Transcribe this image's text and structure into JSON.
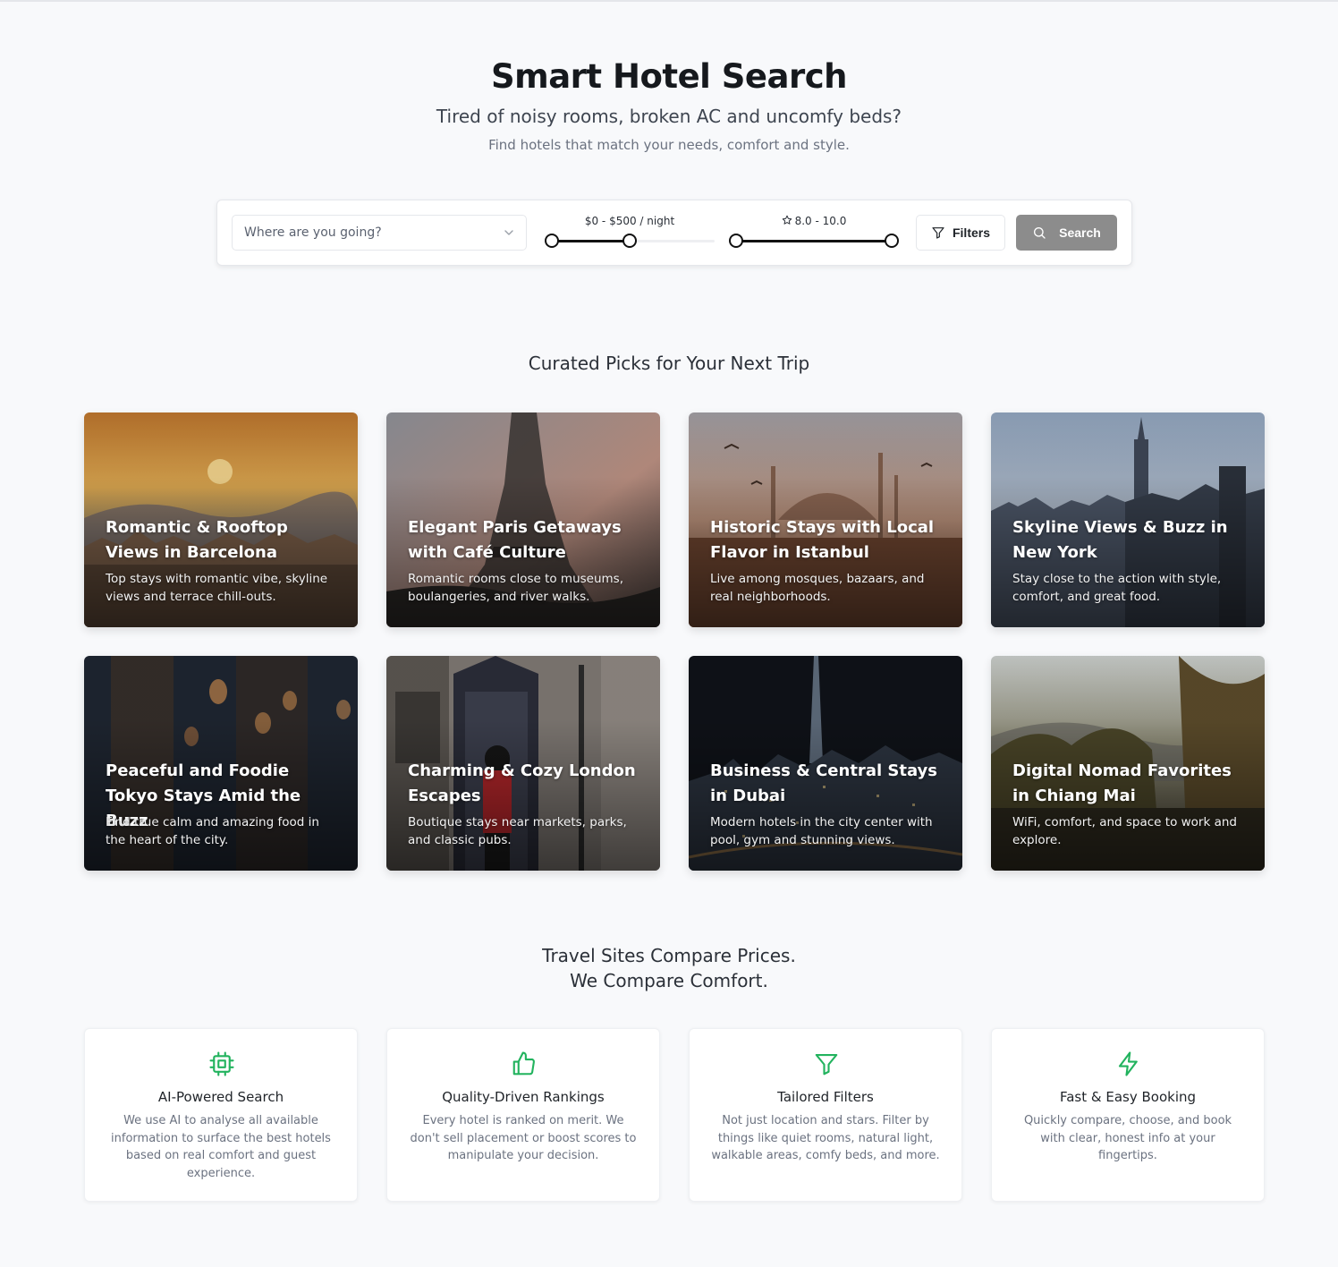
{
  "hero": {
    "title": "Smart Hotel Search",
    "subtitle": "Tired of noisy rooms, broken AC and uncomfy beds?",
    "tagline": "Find hotels that match your needs, comfort and style."
  },
  "search": {
    "destination_placeholder": "Where are you going?",
    "price_label": "$0 - $500 / night",
    "price_range": {
      "min": 0,
      "max": 500,
      "slider_max": 1000
    },
    "rating_label": "8.0 - 10.0",
    "rating_range": {
      "min": 8.0,
      "max": 10.0
    },
    "filters_label": "Filters",
    "search_label": "Search",
    "search_button_color": "#8c8c8c"
  },
  "curated": {
    "title": "Curated Picks for Your Next Trip",
    "cards": [
      {
        "title": "Romantic & Rooftop Views in Barcelona",
        "desc": "Top stays with romantic vibe, skyline views and terrace chill-outs."
      },
      {
        "title": "Elegant Paris Getaways with Café Culture",
        "desc": "Romantic rooms close to museums, boulangeries, and river walks."
      },
      {
        "title": "Historic Stays with Local Flavor in Istanbul",
        "desc": "Live among mosques, bazaars, and real neighborhoods."
      },
      {
        "title": "Skyline Views & Buzz in New York",
        "desc": "Stay close to the action with style, comfort, and great food."
      },
      {
        "title": "Peaceful and Foodie Tokyo Stays Amid the Buzz",
        "desc": "Find true calm and amazing food in the heart of the city."
      },
      {
        "title": "Charming & Cozy London Escapes",
        "desc": "Boutique stays near markets, parks, and classic pubs."
      },
      {
        "title": "Business & Central Stays in Dubai",
        "desc": "Modern hotels in the city center with pool, gym and stunning views."
      },
      {
        "title": "Digital Nomad Favorites in Chiang Mai",
        "desc": "WiFi, comfort, and space to work and explore."
      }
    ]
  },
  "compare": {
    "title_line1": "Travel Sites Compare Prices.",
    "title_line2": "We Compare Comfort.",
    "accent_color": "#22b35e",
    "features": [
      {
        "icon": "cpu-icon",
        "title": "AI-Powered Search",
        "desc": "We use AI to analyse all available information to surface the best hotels based on real comfort and guest experience."
      },
      {
        "icon": "thumbs-up-icon",
        "title": "Quality-Driven Rankings",
        "desc": "Every hotel is ranked on merit. We don't sell placement or boost scores to manipulate your decision."
      },
      {
        "icon": "filter-icon",
        "title": "Tailored Filters",
        "desc": "Not just location and stars. Filter by things like quiet rooms, natural light, walkable areas, comfy beds, and more."
      },
      {
        "icon": "lightning-icon",
        "title": "Fast & Easy Booking",
        "desc": "Quickly compare, choose, and book with clear, honest info at your fingertips."
      }
    ]
  }
}
